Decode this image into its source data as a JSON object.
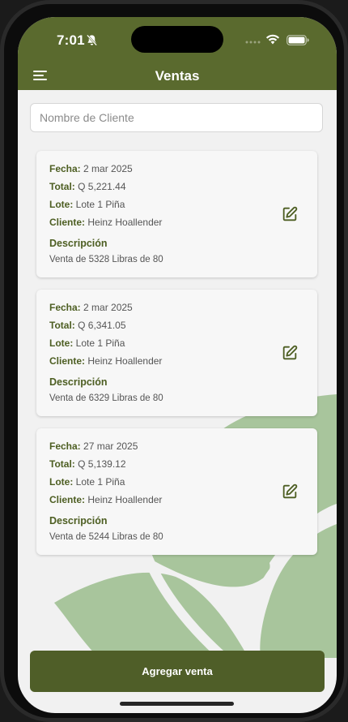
{
  "status": {
    "time": "7:01"
  },
  "header": {
    "title": "Ventas"
  },
  "search": {
    "placeholder": "Nombre de Cliente"
  },
  "labels": {
    "fecha": "Fecha:",
    "total": "Total:",
    "lote": "Lote:",
    "cliente": "Cliente:",
    "descripcion": "Descripción"
  },
  "sales": [
    {
      "fecha": "2 mar 2025",
      "total": "Q 5,221.44",
      "lote": "Lote 1 Piña",
      "cliente": "Heinz Hoallender",
      "descripcion": "Venta de 5328 Libras de 80"
    },
    {
      "fecha": "2 mar 2025",
      "total": "Q 6,341.05",
      "lote": "Lote 1 Piña",
      "cliente": "Heinz Hoallender",
      "descripcion": "Venta de 6329 Libras de 80"
    },
    {
      "fecha": "27 mar 2025",
      "total": "Q 5,139.12",
      "lote": "Lote 1 Piña",
      "cliente": "Heinz Hoallender",
      "descripcion": "Venta de 5244 Libras de 80"
    }
  ],
  "actions": {
    "add_sale": "Agregar venta"
  },
  "colors": {
    "primary": "#5a6a2e",
    "button": "#4f5e28",
    "accent_leaf": "#a8c59c",
    "background": "#f1f1f1"
  },
  "icons": {
    "menu": "menu-icon",
    "edit": "edit-icon",
    "bell_off": "bell-off-icon",
    "wifi": "wifi-icon",
    "battery": "battery-icon"
  }
}
